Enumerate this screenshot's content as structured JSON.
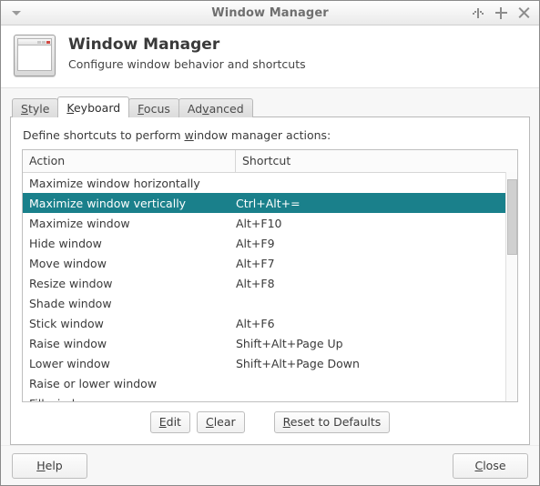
{
  "window": {
    "title": "Window Manager",
    "menu_icon": "window-menu-triangle-icon",
    "buttons": {
      "shade_label": "shade",
      "maximize_label": "maximize",
      "close_label": "close"
    }
  },
  "header": {
    "icon": "window-manager-icon",
    "title": "Window Manager",
    "subtitle": "Configure window behavior and shortcuts"
  },
  "tabs": [
    {
      "label": "Style",
      "mnemonic": "S",
      "active": false
    },
    {
      "label": "Keyboard",
      "mnemonic": "K",
      "active": true
    },
    {
      "label": "Focus",
      "mnemonic": "F",
      "active": false
    },
    {
      "label": "Advanced",
      "mnemonic": "v",
      "active": false
    }
  ],
  "panel": {
    "description": "Define shortcuts to perform window manager actions:",
    "description_mnemonic": "w",
    "columns": [
      "Action",
      "Shortcut"
    ],
    "rows": [
      {
        "action": "Maximize window horizontally",
        "shortcut": "",
        "selected": false
      },
      {
        "action": "Maximize window vertically",
        "shortcut": "Ctrl+Alt+=",
        "selected": true
      },
      {
        "action": "Maximize window",
        "shortcut": "Alt+F10",
        "selected": false
      },
      {
        "action": "Hide window",
        "shortcut": "Alt+F9",
        "selected": false
      },
      {
        "action": "Move window",
        "shortcut": "Alt+F7",
        "selected": false
      },
      {
        "action": "Resize window",
        "shortcut": "Alt+F8",
        "selected": false
      },
      {
        "action": "Shade window",
        "shortcut": "",
        "selected": false
      },
      {
        "action": "Stick window",
        "shortcut": "Alt+F6",
        "selected": false
      },
      {
        "action": "Raise window",
        "shortcut": "Shift+Alt+Page Up",
        "selected": false
      },
      {
        "action": "Lower window",
        "shortcut": "Shift+Alt+Page Down",
        "selected": false
      },
      {
        "action": "Raise or lower window",
        "shortcut": "",
        "selected": false
      },
      {
        "action": "Fill window",
        "shortcut": "",
        "selected": false
      }
    ],
    "scrollbar": {
      "thumb_top_pct": 3,
      "thumb_height_pct": 33
    },
    "buttons": [
      {
        "label": "Edit",
        "mnemonic": "E"
      },
      {
        "label": "Clear",
        "mnemonic": "C"
      },
      {
        "label": "Reset to Defaults",
        "mnemonic": "R"
      }
    ]
  },
  "footer": {
    "help_label": "Help",
    "help_mnemonic": "H",
    "close_label": "Close",
    "close_mnemonic": "C"
  },
  "colors": {
    "selection": "#1a808b",
    "window_bg": "#f7f7f7",
    "panel_bg": "#ffffff",
    "title_text": "#6f6f6f"
  }
}
